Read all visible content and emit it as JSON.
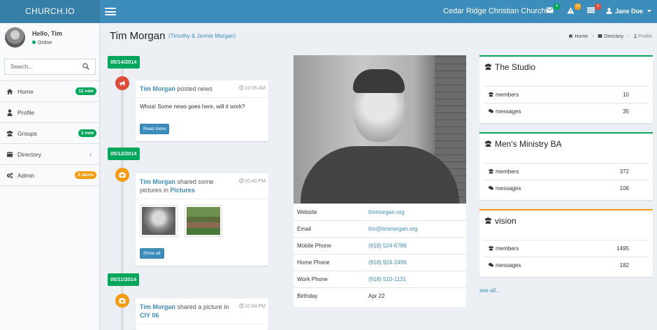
{
  "app": {
    "brand": "CHURCH.IO",
    "church_name": "Cedar Ridge Christian Church",
    "user_name": "Jane Doe",
    "badges": {
      "messages": "4",
      "alerts": "10",
      "tasks": "9"
    },
    "colors": {
      "primary": "#3c8dbc",
      "primary_dark": "#367fa9",
      "success": "#00a65a",
      "warning": "#f39c12",
      "danger": "#dd4b39"
    }
  },
  "sidebar": {
    "greeting": "Hello, Tim",
    "status": "Online",
    "search_placeholder": "Search...",
    "items": [
      {
        "label": "Home",
        "icon": "home-icon",
        "badge": "12 new"
      },
      {
        "label": "Profile",
        "icon": "user-icon",
        "badge": ""
      },
      {
        "label": "Groups",
        "icon": "users-icon",
        "badge": "2 new"
      },
      {
        "label": "Directory",
        "icon": "book-icon",
        "badge": ""
      },
      {
        "label": "Admin",
        "icon": "cogs-icon",
        "badge": "2 alerts"
      }
    ]
  },
  "header": {
    "title": "Tim Morgan",
    "subtitle": "(Timothy & Jennie Morgan)",
    "breadcrumb": {
      "home": "Home",
      "directory": "Directory",
      "current": "Profile"
    }
  },
  "timeline": [
    {
      "date": "05/14/2014",
      "author": "Tim Morgan",
      "action": "posted news",
      "time": "10:36 AM",
      "body": "Whoa! Some news goes here, will it work?",
      "button": "Read more"
    },
    {
      "date": "05/12/2014",
      "author": "Tim Morgan",
      "action": "shared some pictures in",
      "target": "Pictures",
      "time": "10:40 PM",
      "button": "Show all"
    },
    {
      "date": "05/11/2014",
      "author": "Tim Morgan",
      "action": "shared a picture in",
      "target": "CIY 06",
      "time": "10:04 PM"
    }
  ],
  "profile": {
    "fields": [
      {
        "label": "Website",
        "value": "timmorgan.org",
        "link": true
      },
      {
        "label": "Email",
        "value": "tim@timmorgan.org",
        "link": true
      },
      {
        "label": "Mobile Phone",
        "value": "(918) 524-6786",
        "link": true
      },
      {
        "label": "Home Phone",
        "value": "(918) 924-2499",
        "link": true
      },
      {
        "label": "Work Phone",
        "value": "(918) 510-1131",
        "link": true
      },
      {
        "label": "Birthday",
        "value": "Apr 22",
        "link": false
      }
    ]
  },
  "groups": [
    {
      "name": "The Studio",
      "members_label": "members",
      "members": "10",
      "messages_label": "messages",
      "messages": "35",
      "accent": "#00a65a"
    },
    {
      "name": "Men's Ministry BA",
      "members_label": "members",
      "members": "372",
      "messages_label": "messages",
      "messages": "106",
      "accent": "#00a65a"
    },
    {
      "name": "vision",
      "members_label": "members",
      "members": "1495",
      "messages_label": "messages",
      "messages": "182",
      "accent": "#f39c12"
    }
  ],
  "see_all": "see all..."
}
